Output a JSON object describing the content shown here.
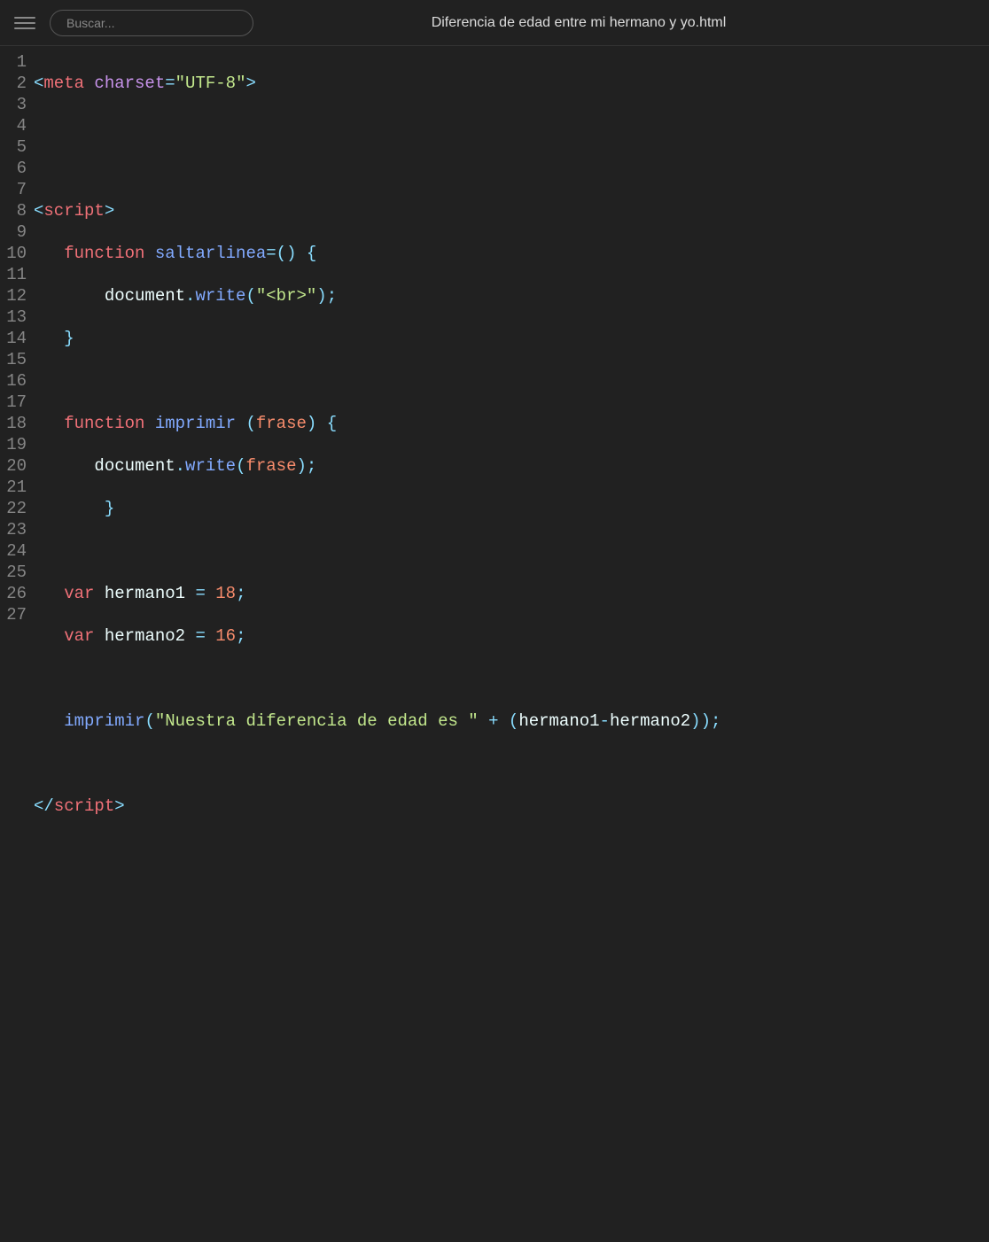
{
  "header": {
    "search_placeholder": "Buscar...",
    "title": "Diferencia de edad entre mi hermano y yo.html"
  },
  "lines": [
    1,
    2,
    3,
    4,
    5,
    6,
    7,
    8,
    9,
    10,
    11,
    12,
    13,
    14,
    15,
    16,
    17,
    18,
    19,
    20,
    21,
    22,
    23,
    24,
    25,
    26,
    27
  ],
  "code": {
    "l1": {
      "open": "<",
      "tag": "meta",
      "sp": " ",
      "attr": "charset",
      "eq": "=",
      "str": "\"UTF-8\"",
      "close": ">"
    },
    "l4": {
      "open": "<",
      "tag": "script",
      "close": ">"
    },
    "l5": {
      "indent": "   ",
      "kw": "function",
      "sp": " ",
      "fn": "saltarlinea",
      "eq": "=",
      "paren": "()",
      "sp2": " ",
      "brace": "{"
    },
    "l6": {
      "indent": "       ",
      "obj": "document",
      "dot": ".",
      "method": "write",
      "open": "(",
      "str": "\"<br>\"",
      "close": ")",
      ";": ";"
    },
    "l7": {
      "indent": "   ",
      "brace": "}"
    },
    "l9": {
      "indent": "   ",
      "kw": "function",
      "sp": " ",
      "fn": "imprimir",
      "sp2": " ",
      "open": "(",
      "param": "frase",
      "close": ")",
      "sp3": " ",
      "brace": "{"
    },
    "l10": {
      "indent": "      ",
      "obj": "document",
      "dot": ".",
      "method": "write",
      "open": "(",
      "param": "frase",
      "close": ")",
      ";": ";"
    },
    "l11": {
      "indent": "       ",
      "brace": "}"
    },
    "l13": {
      "indent": "   ",
      "kw": "var",
      "sp": " ",
      "var": "hermano1",
      "sp2": " ",
      "eq": "=",
      "sp3": " ",
      "num": "18",
      ";": ";"
    },
    "l14": {
      "indent": "   ",
      "kw": "var",
      "sp": " ",
      "var": "hermano2",
      "sp2": " ",
      "eq": "=",
      "sp3": " ",
      "num": "16",
      ";": ";"
    },
    "l16": {
      "indent": "   ",
      "fn": "imprimir",
      "open": "(",
      "str": "\"Nuestra diferencia de edad es \"",
      "sp": " ",
      "plus": "+",
      "sp2": " ",
      "paren": "(",
      "v1": "hermano1",
      "minus": "-",
      "v2": "hermano2",
      "close": "))",
      ";": ";"
    },
    "l18": {
      "open": "</",
      "tag": "script",
      "close": ">"
    }
  }
}
